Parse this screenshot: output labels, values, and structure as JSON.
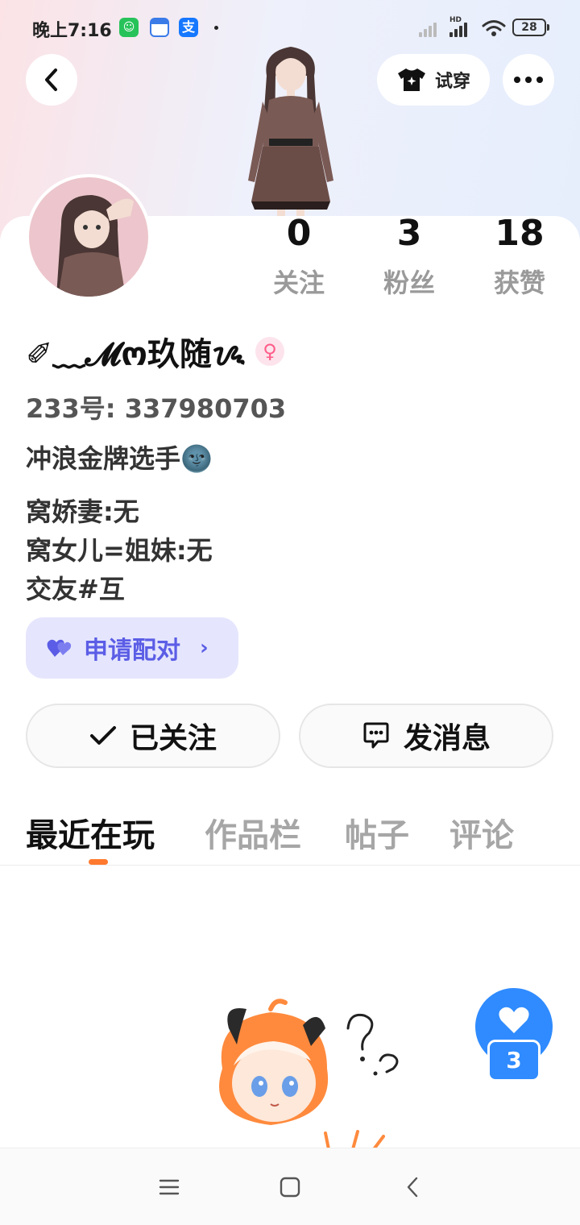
{
  "status_bar": {
    "time": "晚上7:16",
    "alipay_glyph": "支",
    "battery": "28",
    "signal_label": "HD"
  },
  "header": {
    "tryon_label": "试穿",
    "back_icon": "chevron-left-icon",
    "more_icon": "more-dots-icon",
    "tryon_icon": "tshirt-icon"
  },
  "profile": {
    "stats": [
      {
        "num": "0",
        "label": "关注"
      },
      {
        "num": "3",
        "label": "粉丝"
      },
      {
        "num": "18",
        "label": "获赞"
      }
    ],
    "username": "✐﹏𝓜ო玖随ᝰ",
    "gender_symbol": "♀",
    "uid": "233号: 337980703",
    "bio": [
      "冲浪金牌选手🌚",
      "窝娇妻:无",
      "窝女儿=姐妹:无",
      "交友#互"
    ],
    "match_label": "申请配对",
    "follow_label": "已关注",
    "message_label": "发消息"
  },
  "tabs": [
    {
      "label": "最近在玩",
      "active": true
    },
    {
      "label": "作品栏",
      "active": false
    },
    {
      "label": "帖子",
      "active": false
    },
    {
      "label": "评论",
      "active": false
    }
  ],
  "like_fab": {
    "count": "3"
  },
  "colors": {
    "accent_blue": "#2f8bff",
    "match_purple": "#5b5de6",
    "tab_indicator": "#ff7a2f",
    "gender_pink": "#ff5d8a"
  }
}
